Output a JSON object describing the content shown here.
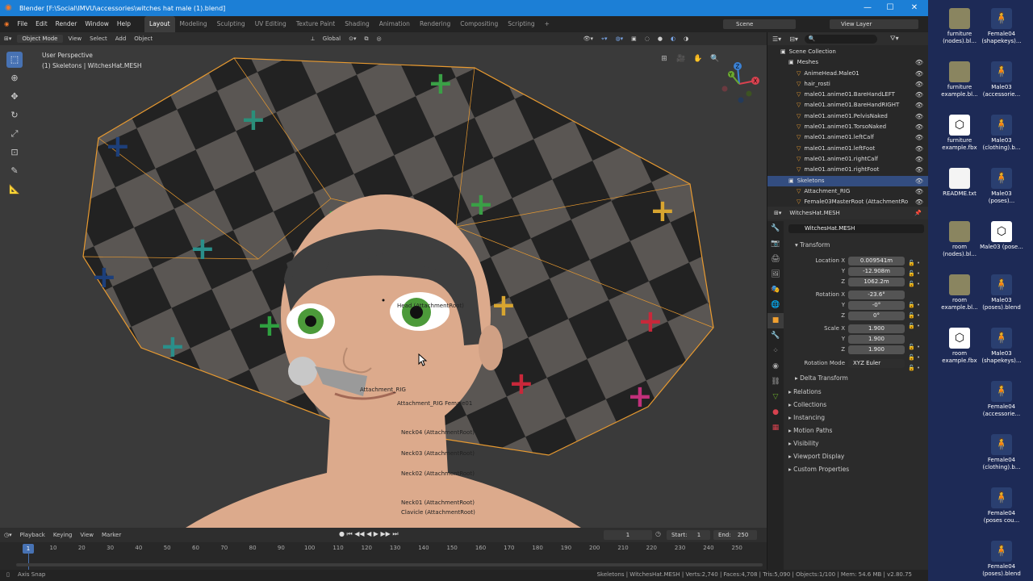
{
  "window": {
    "title": "Blender [F:\\Social\\IMVU\\accessories\\witches hat male (1).blend]",
    "minimize": "—",
    "maximize": "☐",
    "close": "✕"
  },
  "menu": {
    "items": [
      "File",
      "Edit",
      "Render",
      "Window",
      "Help"
    ],
    "workspaces": [
      "Layout",
      "Modeling",
      "Sculpting",
      "UV Editing",
      "Texture Paint",
      "Shading",
      "Animation",
      "Rendering",
      "Compositing",
      "Scripting"
    ],
    "add_workspace": "+",
    "scene": "Scene",
    "view_layer": "View Layer"
  },
  "viewport_header": {
    "mode": "Object Mode",
    "menus": [
      "View",
      "Select",
      "Add",
      "Object"
    ],
    "orientation": "Global"
  },
  "viewport": {
    "perspective": "User Perspective",
    "context": "(1) Skeletons | WitchesHat.MESH",
    "bone_labels": [
      "Head (AttachmentRoot)",
      "Attachment_RIG",
      "Attachment_RIG Female01",
      "Neck04 (AttachmentRoot)",
      "Neck03 (AttachmentRoot)",
      "Neck02 (AttachmentRoot)",
      "Neck01 (AttachmentRoot)",
      "Clavicle (AttachmentRoot)"
    ],
    "gizmo": {
      "x": "X",
      "y": "Y",
      "z": "Z"
    }
  },
  "timeline": {
    "menus": [
      "Playback",
      "Keying",
      "View",
      "Marker"
    ],
    "current_frame": "1",
    "start_label": "Start:",
    "start": "1",
    "end_label": "End:",
    "end": "250",
    "ticks": [
      "10",
      "20",
      "30",
      "40",
      "50",
      "60",
      "70",
      "80",
      "90",
      "100",
      "110",
      "120",
      "130",
      "140",
      "150",
      "160",
      "170",
      "180",
      "190",
      "200",
      "210",
      "220",
      "230",
      "240",
      "250"
    ],
    "playhead": "1"
  },
  "status": {
    "left": "Axis Snap",
    "right": "Skeletons | WitchesHat.MESH | Verts:2,740 | Faces:4,708 | Tris:5,090 | Objects:1/100 | Mem: 54.6 MB | v2.80.75"
  },
  "outliner": {
    "rows": [
      {
        "name": "Scene Collection",
        "indent": 0,
        "selected": false
      },
      {
        "name": "Meshes",
        "indent": 1,
        "selected": false
      },
      {
        "name": "AnimeHead.Male01",
        "indent": 2,
        "selected": false
      },
      {
        "name": "hair_rosti",
        "indent": 2,
        "selected": false
      },
      {
        "name": "male01.anime01.BareHandLEFT",
        "indent": 2,
        "selected": false
      },
      {
        "name": "male01.anime01.BareHandRIGHT",
        "indent": 2,
        "selected": false
      },
      {
        "name": "male01.anime01.PelvisNaked",
        "indent": 2,
        "selected": false
      },
      {
        "name": "male01.anime01.TorsoNaked",
        "indent": 2,
        "selected": false
      },
      {
        "name": "male01.anime01.leftCalf",
        "indent": 2,
        "selected": false
      },
      {
        "name": "male01.anime01.leftFoot",
        "indent": 2,
        "selected": false
      },
      {
        "name": "male01.anime01.rightCalf",
        "indent": 2,
        "selected": false
      },
      {
        "name": "male01.anime01.rightFoot",
        "indent": 2,
        "selected": false
      },
      {
        "name": "Skeletons",
        "indent": 1,
        "selected": true
      },
      {
        "name": "Attachment_RIG",
        "indent": 2,
        "selected": false
      },
      {
        "name": "Female03MasterRoot (AttachmentRo",
        "indent": 2,
        "selected": false
      }
    ]
  },
  "properties": {
    "object_name": "WitchesHat.MESH",
    "object_field": "WitchesHat.MESH",
    "transform_label": "Transform",
    "location_label": "Location X",
    "location": [
      "0.009541m",
      "-12.908m",
      "1062.2m"
    ],
    "rotation_label": "Rotation X",
    "rotation": [
      "-23.6°",
      "-0°",
      "0°"
    ],
    "scale_label": "Scale X",
    "scale": [
      "1.900",
      "1.900",
      "1.900"
    ],
    "axis_y": "Y",
    "axis_z": "Z",
    "rotation_mode_label": "Rotation Mode",
    "rotation_mode": "XYZ Euler",
    "delta": "Delta Transform",
    "panels": [
      "Relations",
      "Collections",
      "Instancing",
      "Motion Paths",
      "Visibility",
      "Viewport Display",
      "Custom Properties"
    ]
  },
  "desktop": {
    "icons": [
      {
        "label": "furniture (nodes).bl...",
        "kind": "img"
      },
      {
        "label": "Female04 (shapekeys)...",
        "kind": "fig"
      },
      {
        "label": "furniture example.bl...",
        "kind": "img"
      },
      {
        "label": "Male03 (accessorie...",
        "kind": "fig"
      },
      {
        "label": "furniture example.fbx",
        "kind": "fbx"
      },
      {
        "label": "Male03 (clothing).b...",
        "kind": "fig"
      },
      {
        "label": "README.txt",
        "kind": "doc"
      },
      {
        "label": "Male03 (poses)...",
        "kind": "fig"
      },
      {
        "label": "room (nodes).bl...",
        "kind": "img"
      },
      {
        "label": "Male03 (pose...",
        "kind": "fbx"
      },
      {
        "label": "room example.bl...",
        "kind": "img"
      },
      {
        "label": "Male03 (poses).blend",
        "kind": "fig"
      },
      {
        "label": "room example.fbx",
        "kind": "fbx"
      },
      {
        "label": "Male03 (shapekeys)...",
        "kind": "fig"
      },
      {
        "label": "Female04 (accessorie...",
        "kind": "fig"
      },
      {
        "label": "Female04 (clothing).b...",
        "kind": "fig"
      },
      {
        "label": "Female04 (poses cou...",
        "kind": "fig"
      },
      {
        "label": "Female04 (poses).blend",
        "kind": "fig"
      }
    ]
  }
}
